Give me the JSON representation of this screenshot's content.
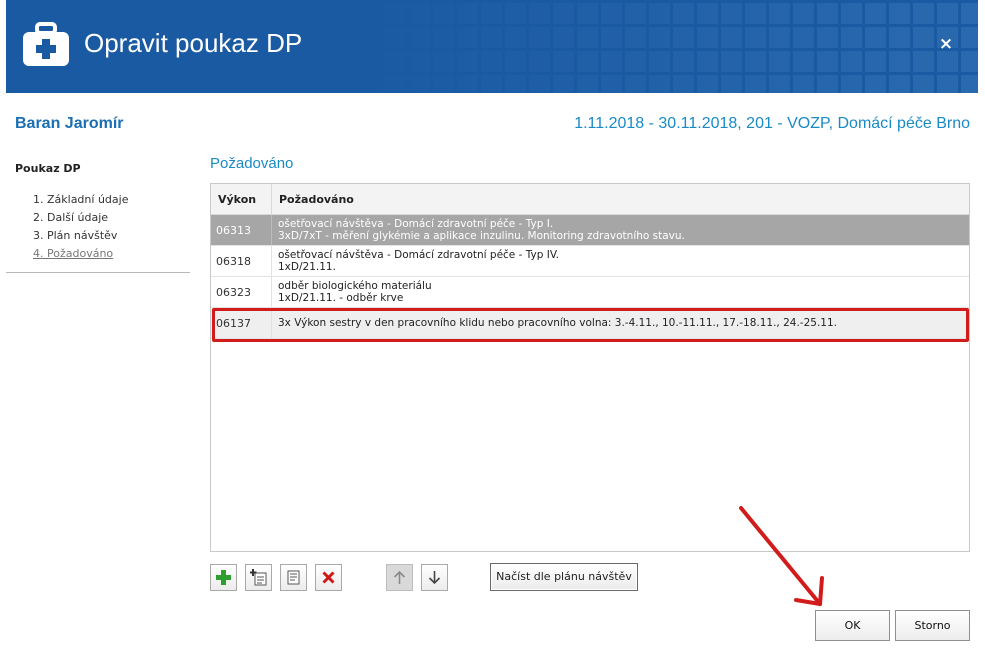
{
  "window": {
    "title": "Opravit poukaz DP",
    "close_label": "×",
    "header_color": "#1a5aa3"
  },
  "patient": {
    "name": "Baran Jaromír",
    "period": "1.11.2018 - 30.11.2018, 201 - VOZP, Domácí péče Brno"
  },
  "nav": {
    "title": "Poukaz DP",
    "items": [
      {
        "label": "1. Základní údaje",
        "active": false
      },
      {
        "label": "2. Další údaje",
        "active": false
      },
      {
        "label": "3. Plán návštěv",
        "active": false
      },
      {
        "label": "4. Požadováno",
        "active": true
      }
    ]
  },
  "section": {
    "title": "Požadováno"
  },
  "grid": {
    "columns": [
      "Výkon",
      "Požadováno"
    ],
    "rows": [
      {
        "code": "06313",
        "line1": "ošetřovací návštěva - Domácí zdravotní péče - Typ I.",
        "line2": "3xD/7xT - měření glykémie a aplikace inzulinu. Monitoring zdravotního stavu.",
        "state": "selected"
      },
      {
        "code": "06318",
        "line1": "ošetřovací návštěva - Domácí zdravotní péče - Typ IV.",
        "line2": "1xD/21.11.",
        "state": "normal"
      },
      {
        "code": "06323",
        "line1": "odběr biologického materiálu",
        "line2": "1xD/21.11. - odběr krve",
        "state": "normal"
      },
      {
        "code": "06137",
        "line1": "3x Výkon sestry v den pracovního klidu nebo pracovního volna: 3.-4.11., 10.-11.11., 17.-18.11., 24.-25.11.",
        "line2": "",
        "state": "highlighted"
      }
    ]
  },
  "toolbar": {
    "add_icon": "plus-icon",
    "copy_icon": "copy-add-icon",
    "edit_icon": "edit-icon",
    "delete_icon": "delete-icon",
    "up_icon": "arrow-up-icon",
    "down_icon": "arrow-down-icon",
    "load_label": "Načíst dle plánu návštěv"
  },
  "footer": {
    "ok_label": "OK",
    "cancel_label": "Storno"
  },
  "colors": {
    "accent": "#1a8ac6",
    "annotation": "#d21c1c",
    "add_green": "#2e9e2e",
    "delete_red": "#d01818"
  }
}
